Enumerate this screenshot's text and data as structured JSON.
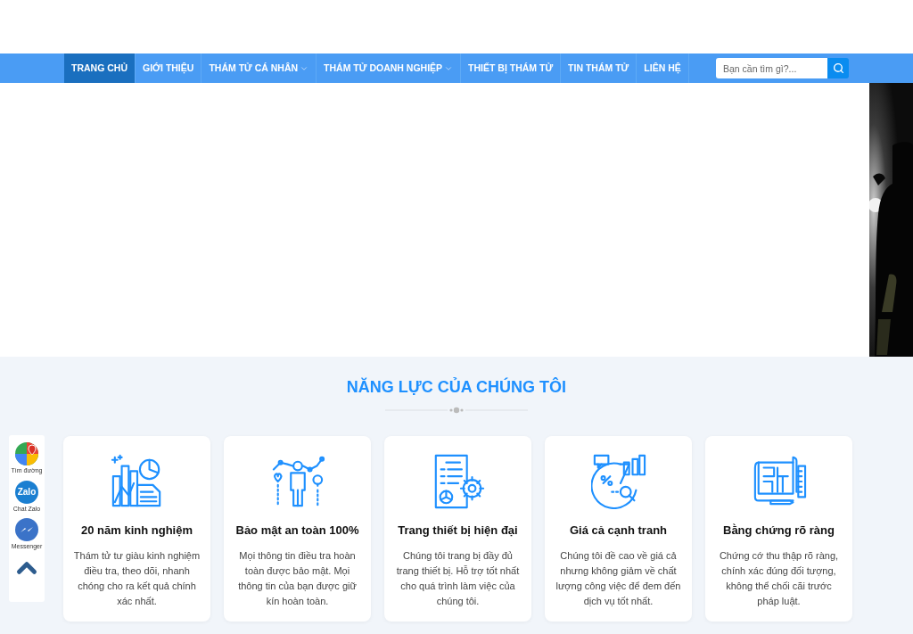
{
  "nav": {
    "items": [
      {
        "label": "TRANG CHỦ",
        "selected": true,
        "dropdown": false
      },
      {
        "label": "GIỚI THIỆU",
        "selected": false,
        "dropdown": false
      },
      {
        "label": "THÁM TỬ CÁ NHÂN",
        "selected": false,
        "dropdown": true
      },
      {
        "label": "THÁM TỬ DOANH NGHIỆP",
        "selected": false,
        "dropdown": true
      },
      {
        "label": "THIẾT BỊ THÁM TỬ",
        "selected": false,
        "dropdown": false
      },
      {
        "label": "TIN THÁM TỬ",
        "selected": false,
        "dropdown": false
      },
      {
        "label": "LIÊN HỆ",
        "selected": false,
        "dropdown": false
      }
    ],
    "search": {
      "placeholder": "Bạn cần tìm gì?..."
    }
  },
  "contact_bar": [
    {
      "label": "Tìm đường"
    },
    {
      "label": "Chat Zalo",
      "icon_text": "Zalo"
    },
    {
      "label": "Messenger"
    }
  ],
  "section": {
    "title": "NĂNG LỰC CỦA CHÚNG TÔI",
    "cards": [
      {
        "title": "20 năm kinh nghiệm",
        "text": "Thám tử tư giàu kinh nghiệm điều tra, theo dõi, nhanh chóng cho ra kết quả chính xác nhất."
      },
      {
        "title": "Bảo mật an toàn 100%",
        "text": "Mọi thông tin điều tra hoàn toàn được bảo mật. Mọi thông tin của bạn được giữ kín hoàn toàn."
      },
      {
        "title": "Trang thiết bị hiện đại",
        "text": "Chúng tôi trang bị đầy đủ trang thiết bị. Hỗ trợ tốt nhất cho quá trình làm việc của chúng tôi."
      },
      {
        "title": "Giá cả cạnh tranh",
        "text": "Chúng tôi đề cao về giá cả nhưng không giảm về chất lượng công việc để đem đến dịch vụ tốt nhất."
      },
      {
        "title": "Bằng chứng rõ ràng",
        "text": "Chứng cớ thu thập rõ ràng, chính xác đúng đối tượng, không thể chối cãi trước pháp luật."
      }
    ]
  }
}
